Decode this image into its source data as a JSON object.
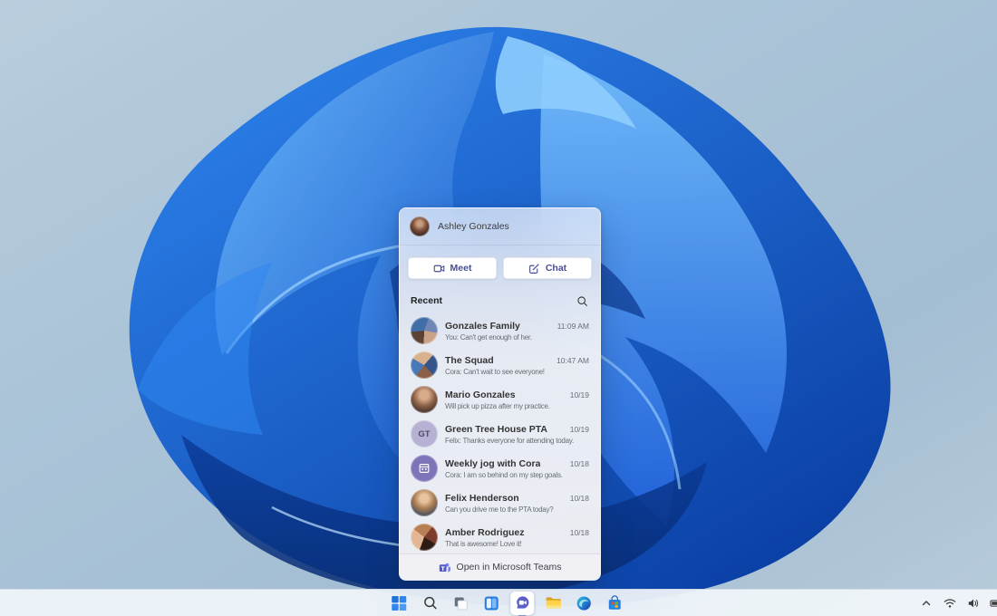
{
  "wallpaper": {
    "name": "windows-11-bloom",
    "base_color": "#abc4d8",
    "bloom_primary": "#1b62d6",
    "bloom_highlight": "#7cc2fb",
    "bloom_shadow": "#0a3a9c"
  },
  "chat_flyout": {
    "header": {
      "user_name": "Ashley Gonzales"
    },
    "actions": {
      "meet_label": "Meet",
      "chat_label": "Chat"
    },
    "recent_label": "Recent",
    "items": [
      {
        "name": "Gonzales Family",
        "preview": "You: Can't get enough of her.",
        "time": "11:09 AM",
        "avatar": "photo-collage"
      },
      {
        "name": "The Squad",
        "preview": "Cora: Can't wait to see everyone!",
        "time": "10:47 AM",
        "avatar": "photo-collage"
      },
      {
        "name": "Mario Gonzales",
        "preview": "Will pick up pizza after my practice.",
        "time": "10/19",
        "avatar": "photo"
      },
      {
        "name": "Green Tree House PTA",
        "preview": "Felix: Thanks everyone for attending today.",
        "time": "10/19",
        "avatar": "initials",
        "initials": "GT"
      },
      {
        "name": "Weekly jog with Cora",
        "preview": "Cora: I am so behind on my step goals.",
        "time": "10/18",
        "avatar": "calendar-icon"
      },
      {
        "name": "Felix Henderson",
        "preview": "Can you drive me to the PTA today?",
        "time": "10/18",
        "avatar": "photo"
      },
      {
        "name": "Amber Rodriguez",
        "preview": "That is awesome! Love it!",
        "time": "10/18",
        "avatar": "photo"
      }
    ],
    "footer": {
      "open_label": "Open in Microsoft Teams"
    }
  },
  "taskbar": {
    "items": [
      "start",
      "search",
      "task-view",
      "widgets",
      "chat",
      "file-explorer",
      "edge",
      "store"
    ],
    "active_item": "chat",
    "tray_items": [
      "hidden-icons-chevron",
      "wifi",
      "volume",
      "battery"
    ]
  },
  "colors": {
    "teams_purple": "#5b5fc7",
    "button_text": "#494f91",
    "taskbar_bg": "#f3f7fb",
    "active_underline": "#7d95c9"
  }
}
